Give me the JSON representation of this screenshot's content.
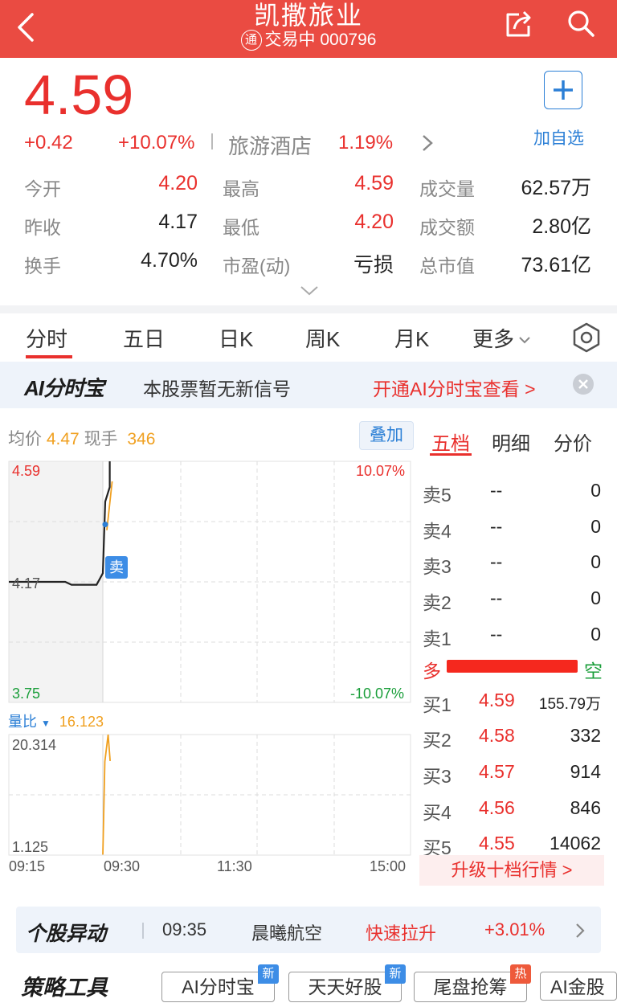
{
  "header": {
    "title": "凯撒旅业",
    "status_badge": "通",
    "status": "交易中 000796"
  },
  "quote": {
    "price": "4.59",
    "change": "+0.42",
    "change_pct": "+10.07%",
    "sector": "旅游酒店",
    "sector_pct": "1.19%",
    "add_watch": "加自选",
    "stats": [
      {
        "label": "今开",
        "value": "4.20",
        "color": "#e9302d"
      },
      {
        "label": "最高",
        "value": "4.59",
        "color": "#e9302d"
      },
      {
        "label": "成交量",
        "value": "62.57万",
        "color": "#222222"
      },
      {
        "label": "昨收",
        "value": "4.17",
        "color": "#222222"
      },
      {
        "label": "最低",
        "value": "4.20",
        "color": "#e9302d"
      },
      {
        "label": "成交额",
        "value": "2.80亿",
        "color": "#222222"
      },
      {
        "label": "换手",
        "value": "4.70%",
        "color": "#222222"
      },
      {
        "label": "市盈(动)",
        "value": "亏损",
        "color": "#222222"
      },
      {
        "label": "总市值",
        "value": "73.61亿",
        "color": "#222222"
      }
    ]
  },
  "tabs": [
    "分时",
    "五日",
    "日K",
    "周K",
    "月K",
    "更多"
  ],
  "ai_banner": {
    "logo": "AI分时宝",
    "message": "本股票暂无新信号",
    "link": "开通AI分时宝查看 >"
  },
  "chart_info": {
    "avg_label": "均价",
    "avg_value": "4.47",
    "now_label": "现手",
    "now_value": "346",
    "overlay": "叠加"
  },
  "chart_data": [
    {
      "type": "line",
      "y_labels_left": [
        "4.59",
        "4.17",
        "3.75"
      ],
      "y_labels_right": [
        "10.07%",
        "-10.07%"
      ],
      "ylim": [
        3.75,
        4.59
      ],
      "reference": 4.17,
      "x_labels": [
        "09:15",
        "09:30",
        "11:30",
        "15:00"
      ],
      "series": [
        {
          "values_time": [
            "09:15",
            "09:24",
            "09:25",
            "09:29",
            "09:30",
            "09:30",
            "09:31",
            "09:31"
          ],
          "values": [
            4.17,
            4.17,
            4.16,
            4.16,
            4.2,
            4.45,
            4.5,
            4.59
          ]
        },
        {
          "values_time": [
            "09:30",
            "09:31"
          ],
          "values": [
            4.35,
            4.52
          ]
        }
      ],
      "marker": "卖"
    },
    {
      "type": "line",
      "title": "量比",
      "current": "16.123",
      "y_labels": [
        "20.314",
        "1.125"
      ],
      "ylim": [
        1.125,
        20.314
      ],
      "series": [
        {
          "values_time": [
            "09:30",
            "09:30",
            "09:31",
            "09:31"
          ],
          "values": [
            1.2,
            16,
            20.3,
            16.1
          ]
        }
      ]
    }
  ],
  "orderbook": {
    "tabs": [
      "五档",
      "明细",
      "分价"
    ],
    "sells": [
      {
        "label": "卖5",
        "price": "--",
        "vol": "0"
      },
      {
        "label": "卖4",
        "price": "--",
        "vol": "0"
      },
      {
        "label": "卖3",
        "price": "--",
        "vol": "0"
      },
      {
        "label": "卖2",
        "price": "--",
        "vol": "0"
      },
      {
        "label": "卖1",
        "price": "--",
        "vol": "0"
      }
    ],
    "bull": "多",
    "bear": "空",
    "buys": [
      {
        "label": "买1",
        "price": "4.59",
        "vol": "155.79万"
      },
      {
        "label": "买2",
        "price": "4.58",
        "vol": "332"
      },
      {
        "label": "买3",
        "price": "4.57",
        "vol": "914"
      },
      {
        "label": "买4",
        "price": "4.56",
        "vol": "846"
      },
      {
        "label": "买5",
        "price": "4.55",
        "vol": "14062"
      }
    ],
    "upgrade": "升级十档行情 >"
  },
  "movement": {
    "logo": "个股异动",
    "time": "09:35",
    "name": "晨曦航空",
    "event": "快速拉升",
    "pct": "+3.01%"
  },
  "tools": {
    "logo": "策略工具",
    "chips": [
      {
        "label": "AI分时宝",
        "badge": "新"
      },
      {
        "label": "天天好股",
        "badge": "新"
      },
      {
        "label": "尾盘抢筹",
        "badge": "热"
      },
      {
        "label": "AI金股",
        "badge": ""
      }
    ]
  }
}
